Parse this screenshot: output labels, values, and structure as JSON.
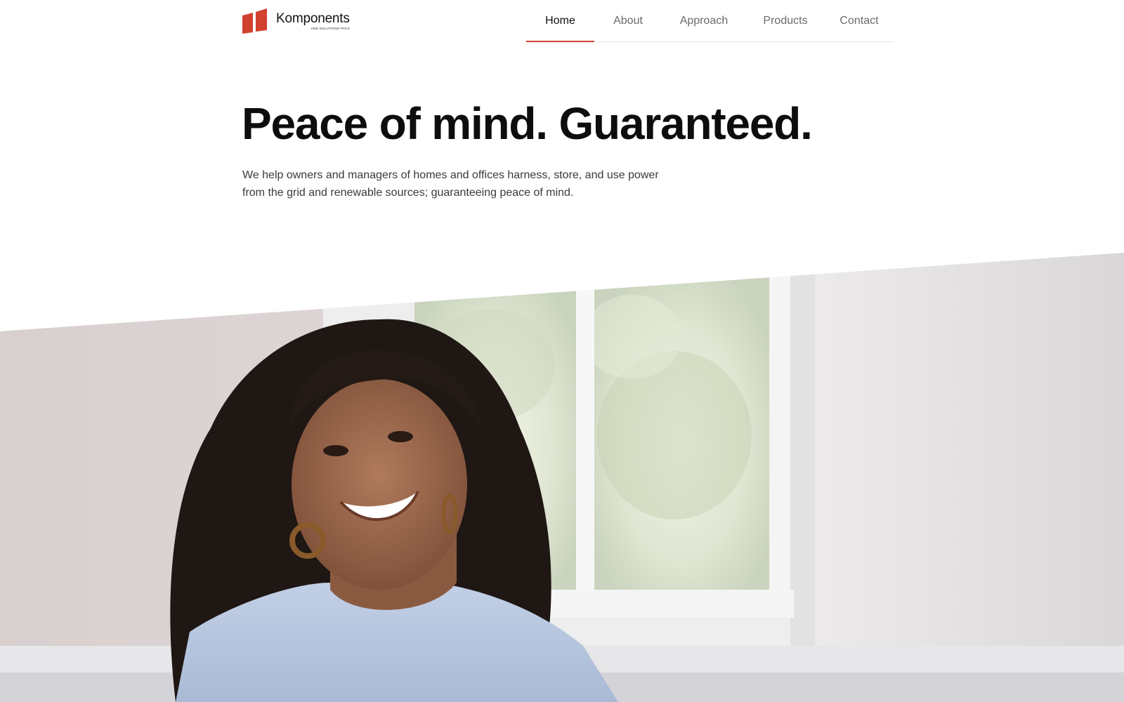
{
  "brand": {
    "name": "Komponents",
    "tagline": "AND SOLUTIONS PACK",
    "accent_color": "#d2412f",
    "logo_icon": "logo-mark-icon"
  },
  "nav": {
    "items": [
      {
        "label": "Home",
        "active": true
      },
      {
        "label": "About",
        "active": false
      },
      {
        "label": "Approach",
        "active": false
      },
      {
        "label": "Products",
        "active": false
      },
      {
        "label": "Contact",
        "active": false
      }
    ]
  },
  "hero": {
    "title": "Peace of mind. Guaranteed.",
    "description": "We help owners and managers of homes and offices harness, store, and use power from the grid and renewable sources; guaranteeing peace of mind."
  }
}
